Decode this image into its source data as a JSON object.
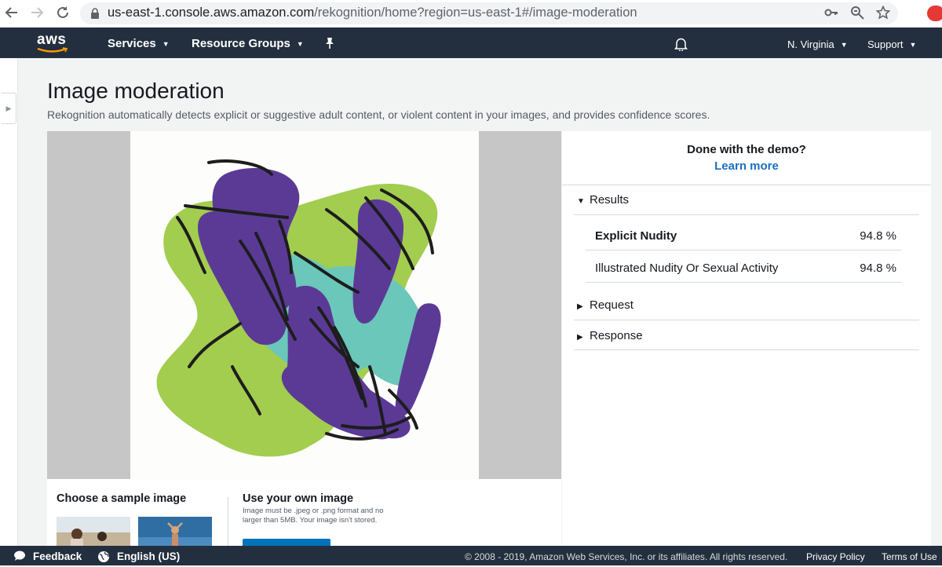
{
  "browser": {
    "url_host": "us-east-1.console.aws.amazon.com",
    "url_path": "/rekognition/home?region=us-east-1#/image-moderation"
  },
  "nav": {
    "logo": "aws",
    "services": "Services",
    "resource_groups": "Resource Groups",
    "region": "N. Virginia",
    "support": "Support",
    "icons": [
      "back-arrow-icon",
      "forward-arrow-icon",
      "reload-icon",
      "lock-icon",
      "key-icon",
      "zoom-icon",
      "star-icon",
      "pin-icon",
      "bell-icon",
      "caret-down-icon"
    ]
  },
  "page": {
    "title": "Image moderation",
    "description": "Rekognition automatically detects explicit or suggestive adult content, or violent content in your images, and provides confidence scores."
  },
  "samples": {
    "heading": "Choose a sample image",
    "own_heading": "Use your own image",
    "own_note": "Image must be .jpeg or .png format and no larger than 5MB. Your image isn't stored."
  },
  "results_panel": {
    "done_text": "Done with the demo?",
    "learn_more": "Learn more",
    "results_label": "Results",
    "results": [
      {
        "label": "Explicit Nudity",
        "value": "94.8 %"
      },
      {
        "label": "Illustrated Nudity Or Sexual Activity",
        "value": "94.8 %"
      }
    ],
    "request_label": "Request",
    "response_label": "Response"
  },
  "footer": {
    "feedback": "Feedback",
    "language": "English (US)",
    "copyright": "© 2008 - 2019, Amazon Web Services, Inc. or its affiliates. All rights reserved.",
    "privacy": "Privacy Policy",
    "terms": "Terms of Use"
  },
  "colors": {
    "nav_bg": "#232f3e",
    "link_blue": "#1b6ec2",
    "art_green": "#a3cd4f",
    "art_purple": "#5b3a96",
    "art_teal": "#6ac7b9"
  }
}
